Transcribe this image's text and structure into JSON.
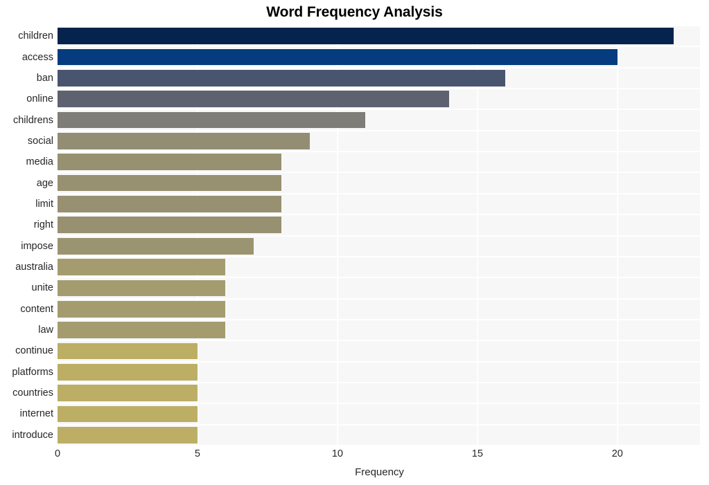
{
  "chart_data": {
    "type": "bar",
    "orientation": "horizontal",
    "title": "Word Frequency Analysis",
    "xlabel": "Frequency",
    "ylabel": "",
    "categories": [
      "children",
      "access",
      "ban",
      "online",
      "childrens",
      "social",
      "media",
      "age",
      "limit",
      "right",
      "impose",
      "australia",
      "unite",
      "content",
      "law",
      "continue",
      "platforms",
      "countries",
      "internet",
      "introduce"
    ],
    "values": [
      22,
      20,
      16,
      14,
      11,
      9,
      8,
      8,
      8,
      8,
      7,
      6,
      6,
      6,
      6,
      5,
      5,
      5,
      5,
      5
    ],
    "bar_colors": [
      "#05234d",
      "#043c7f",
      "#49546f",
      "#5d6170",
      "#7e7d78",
      "#938d74",
      "#979071",
      "#979071",
      "#979071",
      "#979071",
      "#9b9471",
      "#a49c6f",
      "#a49c6f",
      "#a49c6f",
      "#a49c6f",
      "#bcae64",
      "#bcae64",
      "#bcae64",
      "#bcae64",
      "#bcae64"
    ],
    "xlim": [
      0,
      23
    ],
    "xticks": [
      0,
      5,
      10,
      15,
      20
    ],
    "xtick_labels": [
      "0",
      "5",
      "10",
      "15",
      "20"
    ],
    "grid": true,
    "grid_color": "#ffffff",
    "plot_background": "#f7f7f7",
    "figure_background": "#ffffff",
    "legend": null,
    "annotations": []
  }
}
